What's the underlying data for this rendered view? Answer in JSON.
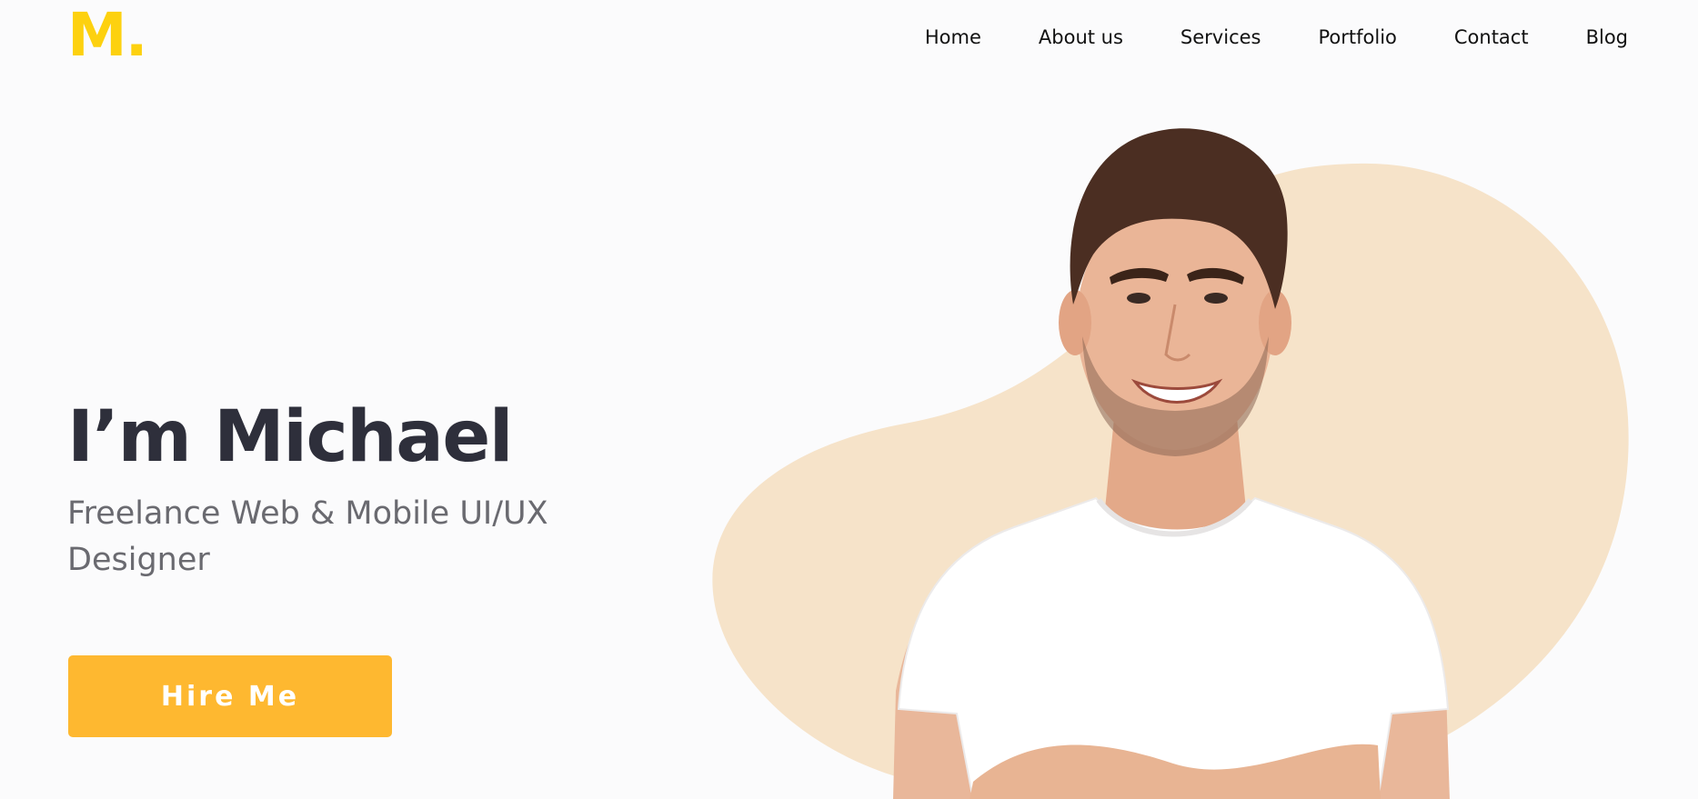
{
  "brand": {
    "logo_text": "M.",
    "accent_color": "#fdd10f"
  },
  "nav": {
    "items": [
      {
        "label": "Home"
      },
      {
        "label": "About us"
      },
      {
        "label": "Services"
      },
      {
        "label": "Portfolio"
      },
      {
        "label": "Contact"
      },
      {
        "label": "Blog"
      }
    ]
  },
  "hero": {
    "title": "I’m Michael",
    "subtitle": "Freelance Web & Mobile UI/UX Designer",
    "cta_label": "Hire Me",
    "cta_color": "#feb830",
    "blob_color": "#f6e3c9",
    "image": "portrait-photo"
  }
}
